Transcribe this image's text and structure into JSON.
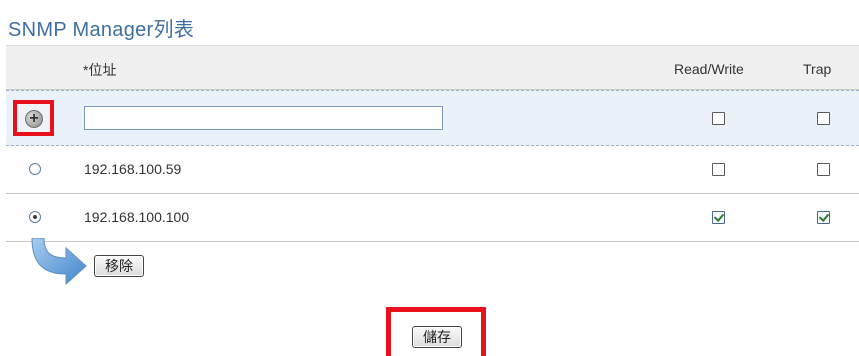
{
  "page": {
    "title": "SNMP Manager列表"
  },
  "table": {
    "headers": {
      "address": "*位址",
      "read_write": "Read/Write",
      "trap": "Trap"
    },
    "add_row": {
      "address_value": "",
      "read_write": false,
      "trap": false
    },
    "rows": [
      {
        "address": "192.168.100.59",
        "selected": false,
        "read_write": false,
        "trap": false
      },
      {
        "address": "192.168.100.100",
        "selected": true,
        "read_write": true,
        "trap": true
      }
    ]
  },
  "actions": {
    "add_symbol": "+",
    "remove_label": "移除",
    "save_label": "儲存"
  },
  "colors": {
    "title": "#3f6fa0",
    "highlight_box": "#e8101a",
    "add_row_bg": "#eaf1f8",
    "arrow": "#4a8ed0"
  }
}
